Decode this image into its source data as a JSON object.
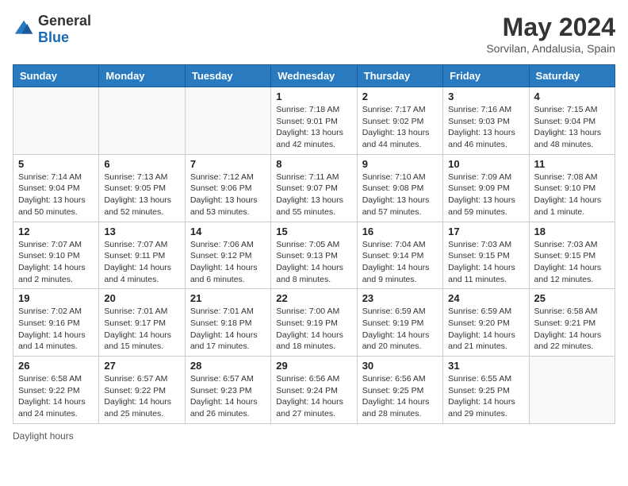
{
  "header": {
    "logo": {
      "general": "General",
      "blue": "Blue"
    },
    "title": "May 2024",
    "subtitle": "Sorvilan, Andalusia, Spain"
  },
  "calendar": {
    "days_of_week": [
      "Sunday",
      "Monday",
      "Tuesday",
      "Wednesday",
      "Thursday",
      "Friday",
      "Saturday"
    ],
    "weeks": [
      [
        {
          "day": "",
          "info": ""
        },
        {
          "day": "",
          "info": ""
        },
        {
          "day": "",
          "info": ""
        },
        {
          "day": "1",
          "info": "Sunrise: 7:18 AM\nSunset: 9:01 PM\nDaylight: 13 hours\nand 42 minutes."
        },
        {
          "day": "2",
          "info": "Sunrise: 7:17 AM\nSunset: 9:02 PM\nDaylight: 13 hours\nand 44 minutes."
        },
        {
          "day": "3",
          "info": "Sunrise: 7:16 AM\nSunset: 9:03 PM\nDaylight: 13 hours\nand 46 minutes."
        },
        {
          "day": "4",
          "info": "Sunrise: 7:15 AM\nSunset: 9:04 PM\nDaylight: 13 hours\nand 48 minutes."
        }
      ],
      [
        {
          "day": "5",
          "info": "Sunrise: 7:14 AM\nSunset: 9:04 PM\nDaylight: 13 hours\nand 50 minutes."
        },
        {
          "day": "6",
          "info": "Sunrise: 7:13 AM\nSunset: 9:05 PM\nDaylight: 13 hours\nand 52 minutes."
        },
        {
          "day": "7",
          "info": "Sunrise: 7:12 AM\nSunset: 9:06 PM\nDaylight: 13 hours\nand 53 minutes."
        },
        {
          "day": "8",
          "info": "Sunrise: 7:11 AM\nSunset: 9:07 PM\nDaylight: 13 hours\nand 55 minutes."
        },
        {
          "day": "9",
          "info": "Sunrise: 7:10 AM\nSunset: 9:08 PM\nDaylight: 13 hours\nand 57 minutes."
        },
        {
          "day": "10",
          "info": "Sunrise: 7:09 AM\nSunset: 9:09 PM\nDaylight: 13 hours\nand 59 minutes."
        },
        {
          "day": "11",
          "info": "Sunrise: 7:08 AM\nSunset: 9:10 PM\nDaylight: 14 hours\nand 1 minute."
        }
      ],
      [
        {
          "day": "12",
          "info": "Sunrise: 7:07 AM\nSunset: 9:10 PM\nDaylight: 14 hours\nand 2 minutes."
        },
        {
          "day": "13",
          "info": "Sunrise: 7:07 AM\nSunset: 9:11 PM\nDaylight: 14 hours\nand 4 minutes."
        },
        {
          "day": "14",
          "info": "Sunrise: 7:06 AM\nSunset: 9:12 PM\nDaylight: 14 hours\nand 6 minutes."
        },
        {
          "day": "15",
          "info": "Sunrise: 7:05 AM\nSunset: 9:13 PM\nDaylight: 14 hours\nand 8 minutes."
        },
        {
          "day": "16",
          "info": "Sunrise: 7:04 AM\nSunset: 9:14 PM\nDaylight: 14 hours\nand 9 minutes."
        },
        {
          "day": "17",
          "info": "Sunrise: 7:03 AM\nSunset: 9:15 PM\nDaylight: 14 hours\nand 11 minutes."
        },
        {
          "day": "18",
          "info": "Sunrise: 7:03 AM\nSunset: 9:15 PM\nDaylight: 14 hours\nand 12 minutes."
        }
      ],
      [
        {
          "day": "19",
          "info": "Sunrise: 7:02 AM\nSunset: 9:16 PM\nDaylight: 14 hours\nand 14 minutes."
        },
        {
          "day": "20",
          "info": "Sunrise: 7:01 AM\nSunset: 9:17 PM\nDaylight: 14 hours\nand 15 minutes."
        },
        {
          "day": "21",
          "info": "Sunrise: 7:01 AM\nSunset: 9:18 PM\nDaylight: 14 hours\nand 17 minutes."
        },
        {
          "day": "22",
          "info": "Sunrise: 7:00 AM\nSunset: 9:19 PM\nDaylight: 14 hours\nand 18 minutes."
        },
        {
          "day": "23",
          "info": "Sunrise: 6:59 AM\nSunset: 9:19 PM\nDaylight: 14 hours\nand 20 minutes."
        },
        {
          "day": "24",
          "info": "Sunrise: 6:59 AM\nSunset: 9:20 PM\nDaylight: 14 hours\nand 21 minutes."
        },
        {
          "day": "25",
          "info": "Sunrise: 6:58 AM\nSunset: 9:21 PM\nDaylight: 14 hours\nand 22 minutes."
        }
      ],
      [
        {
          "day": "26",
          "info": "Sunrise: 6:58 AM\nSunset: 9:22 PM\nDaylight: 14 hours\nand 24 minutes."
        },
        {
          "day": "27",
          "info": "Sunrise: 6:57 AM\nSunset: 9:22 PM\nDaylight: 14 hours\nand 25 minutes."
        },
        {
          "day": "28",
          "info": "Sunrise: 6:57 AM\nSunset: 9:23 PM\nDaylight: 14 hours\nand 26 minutes."
        },
        {
          "day": "29",
          "info": "Sunrise: 6:56 AM\nSunset: 9:24 PM\nDaylight: 14 hours\nand 27 minutes."
        },
        {
          "day": "30",
          "info": "Sunrise: 6:56 AM\nSunset: 9:25 PM\nDaylight: 14 hours\nand 28 minutes."
        },
        {
          "day": "31",
          "info": "Sunrise: 6:55 AM\nSunset: 9:25 PM\nDaylight: 14 hours\nand 29 minutes."
        },
        {
          "day": "",
          "info": ""
        }
      ]
    ]
  },
  "footer": {
    "note": "Daylight hours"
  }
}
